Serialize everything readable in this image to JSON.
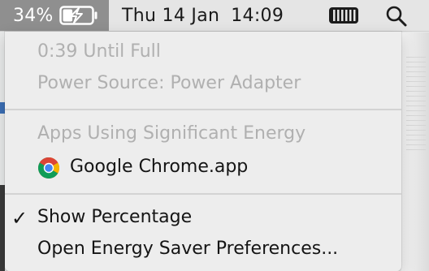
{
  "menubar": {
    "battery_percentage": "34%",
    "date": "Thu 14 Jan",
    "time": "14:09",
    "battery_fill_fraction": 0.34
  },
  "battery_menu": {
    "time_until_full": "0:39 Until Full",
    "power_source": "Power Source: Power Adapter",
    "apps_header": "Apps Using Significant Energy",
    "apps": [
      {
        "name": "Google Chrome.app",
        "icon": "chrome-icon"
      }
    ],
    "show_percentage": "Show Percentage",
    "show_percentage_checked": true,
    "checkmark": "✓",
    "open_prefs": "Open Energy Saver Preferences..."
  },
  "colors": {
    "menubar_bg": "#e5e5e5",
    "battery_highlight": "#8f8f8f",
    "disabled_text": "#b0b0b0",
    "enabled_text": "#151515"
  }
}
